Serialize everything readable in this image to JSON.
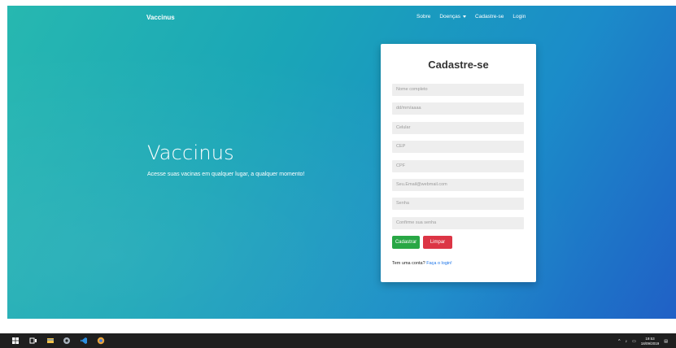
{
  "navbar": {
    "brand": "Vaccinus",
    "links": [
      {
        "label": "Sobre"
      },
      {
        "label": "Doenças"
      },
      {
        "label": "Cadastre-se"
      },
      {
        "label": "Login"
      }
    ]
  },
  "hero": {
    "title": "Vaccinus",
    "subtitle": "Acesse suas vacinas em qualquer lugar, a qualquer momento!"
  },
  "form": {
    "title": "Cadastre-se",
    "fields": [
      {
        "placeholder": "Nome completo"
      },
      {
        "placeholder": "dd/mm/aaaa"
      },
      {
        "placeholder": "Celular"
      },
      {
        "placeholder": "CEP"
      },
      {
        "placeholder": "CPF"
      },
      {
        "placeholder": "Seu.Email@webmail.com"
      },
      {
        "placeholder": "Senha"
      },
      {
        "placeholder": "Confirme sua senha"
      }
    ],
    "submit_label": "Cadastrar",
    "clear_label": "Limpar",
    "login_prompt": "Tem uma conta?",
    "login_link": "Faça o login!"
  },
  "taskbar": {
    "apps": [
      "start-icon",
      "task-view-icon",
      "file-explorer-icon",
      "browser-icon",
      "vscode-icon",
      "chrome-icon"
    ],
    "time": "19:53",
    "date": "18/09/2019"
  },
  "colors": {
    "gradient_start": "#27b8b0",
    "gradient_end": "#2060c6",
    "success": "#28a745",
    "danger": "#dc3545"
  }
}
